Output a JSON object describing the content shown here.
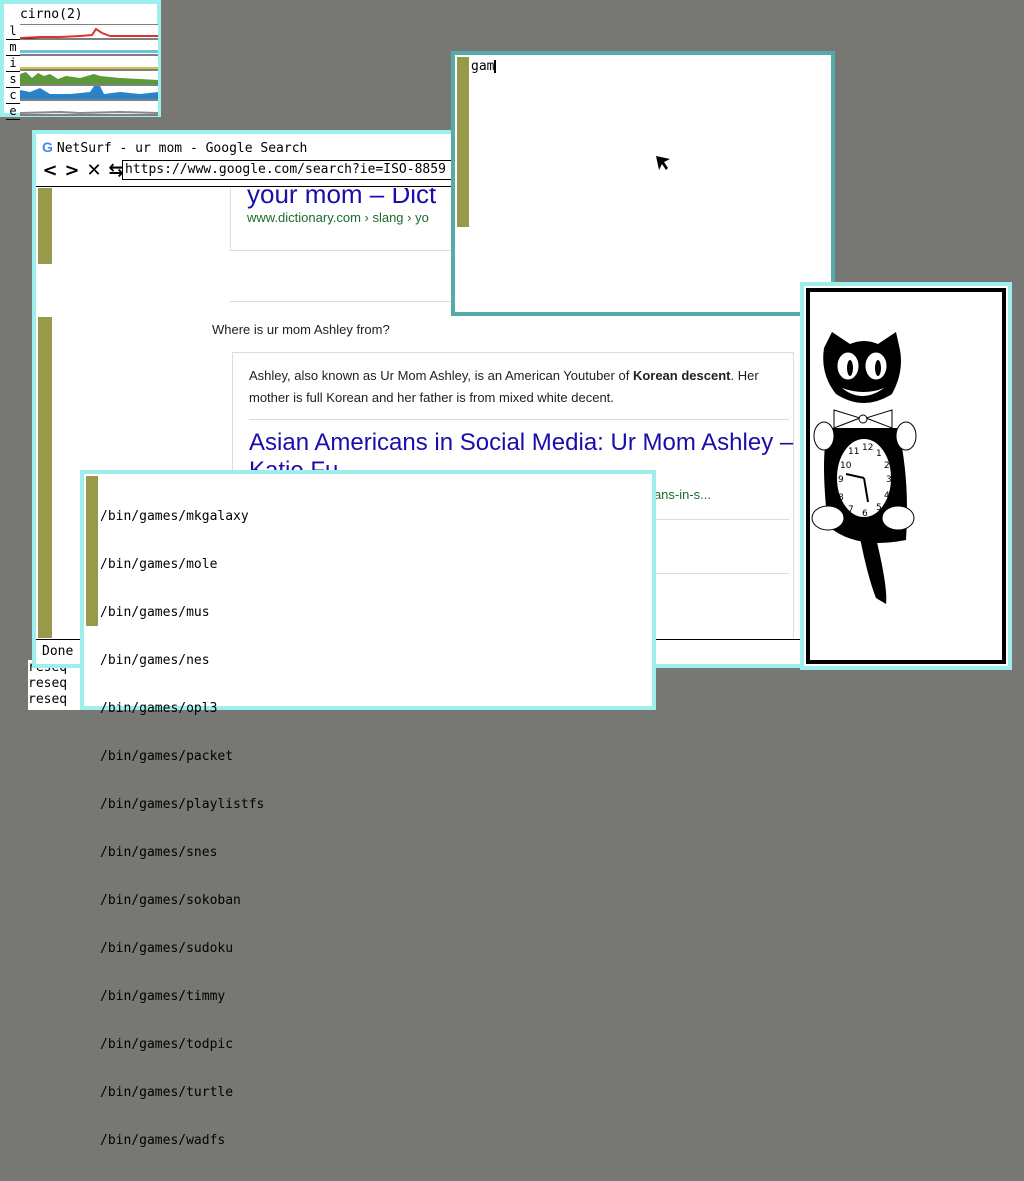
{
  "stats": {
    "title": "cirno(2)",
    "labels": [
      "l",
      "m",
      "i",
      "s",
      "c",
      "e"
    ]
  },
  "netsurf": {
    "title": "NetSurf - ur mom - Google Search",
    "favicon": "google-g-icon",
    "nav": {
      "back": "<",
      "forward": ">",
      "stop": "✕",
      "reload": "⇆"
    },
    "url": "https://www.google.com/search?ie=ISO-8859",
    "status": "Done",
    "page": {
      "top_heading": "your mom – Dict",
      "top_crumb": "www.dictionary.com › slang › yo",
      "question": "Where is ur mom Ashley from?",
      "answer_pre": "Ashley, also known as Ur Mom Ashley, is an American Youtuber of ",
      "answer_bold": "Korean descent",
      "answer_post": ". Her mother is full Korean and her father is from mixed white decent.",
      "result_heading": "Asian Americans in Social Media: Ur Mom Ashley – Katie Fu",
      "result_url_tail": "ericans-in-s..."
    }
  },
  "rio": {
    "typed": "gam"
  },
  "files": {
    "items": [
      "/bin/games/mkgalaxy",
      "/bin/games/mole",
      "/bin/games/mus",
      "/bin/games/nes",
      "/bin/games/opl3",
      "/bin/games/packet",
      "/bin/games/playlistfs",
      "/bin/games/snes",
      "/bin/games/sokoban",
      "/bin/games/sudoku",
      "/bin/games/timmy",
      "/bin/games/todpic",
      "/bin/games/turtle",
      "/bin/games/wadfs"
    ]
  },
  "terminal": {
    "lines": [
      "reseq",
      "reseq",
      "reseq"
    ]
  },
  "clock": {
    "numerals": [
      "12",
      "1",
      "2",
      "3",
      "4",
      "5",
      "6",
      "7",
      "8",
      "9",
      "10",
      "11"
    ]
  },
  "colors": {
    "desktop": "#777774",
    "border_inactive": "#9eeeee",
    "border_active": "#55aaaa",
    "scrollbar": "#99994c",
    "link": "#1a0dab"
  }
}
